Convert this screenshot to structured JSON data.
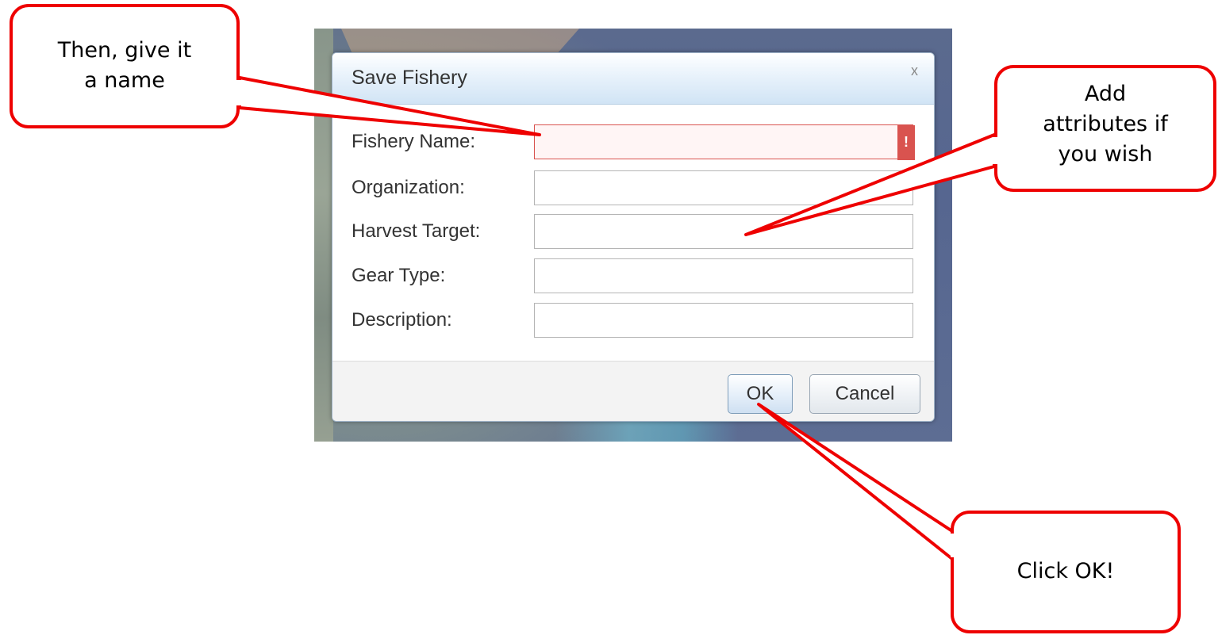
{
  "dialog": {
    "title": "Save Fishery",
    "close_label": "x",
    "fields": [
      {
        "label": "Fishery Name:",
        "value": "",
        "error_marker": "!"
      },
      {
        "label": "Organization:",
        "value": ""
      },
      {
        "label": "Harvest Target:",
        "value": ""
      },
      {
        "label": "Gear Type:",
        "value": ""
      },
      {
        "label": "Description:",
        "value": ""
      }
    ],
    "ok_label": "OK",
    "cancel_label": "Cancel"
  },
  "callouts": {
    "name": [
      "Then, give it",
      "a name"
    ],
    "attributes": [
      "Add",
      "attributes if",
      "you wish"
    ],
    "ok": [
      "Click OK!"
    ]
  },
  "colors": {
    "callout_border": "#ee0000",
    "error": "#d9534f",
    "header_gradient_bottom": "#d1e4f5"
  }
}
